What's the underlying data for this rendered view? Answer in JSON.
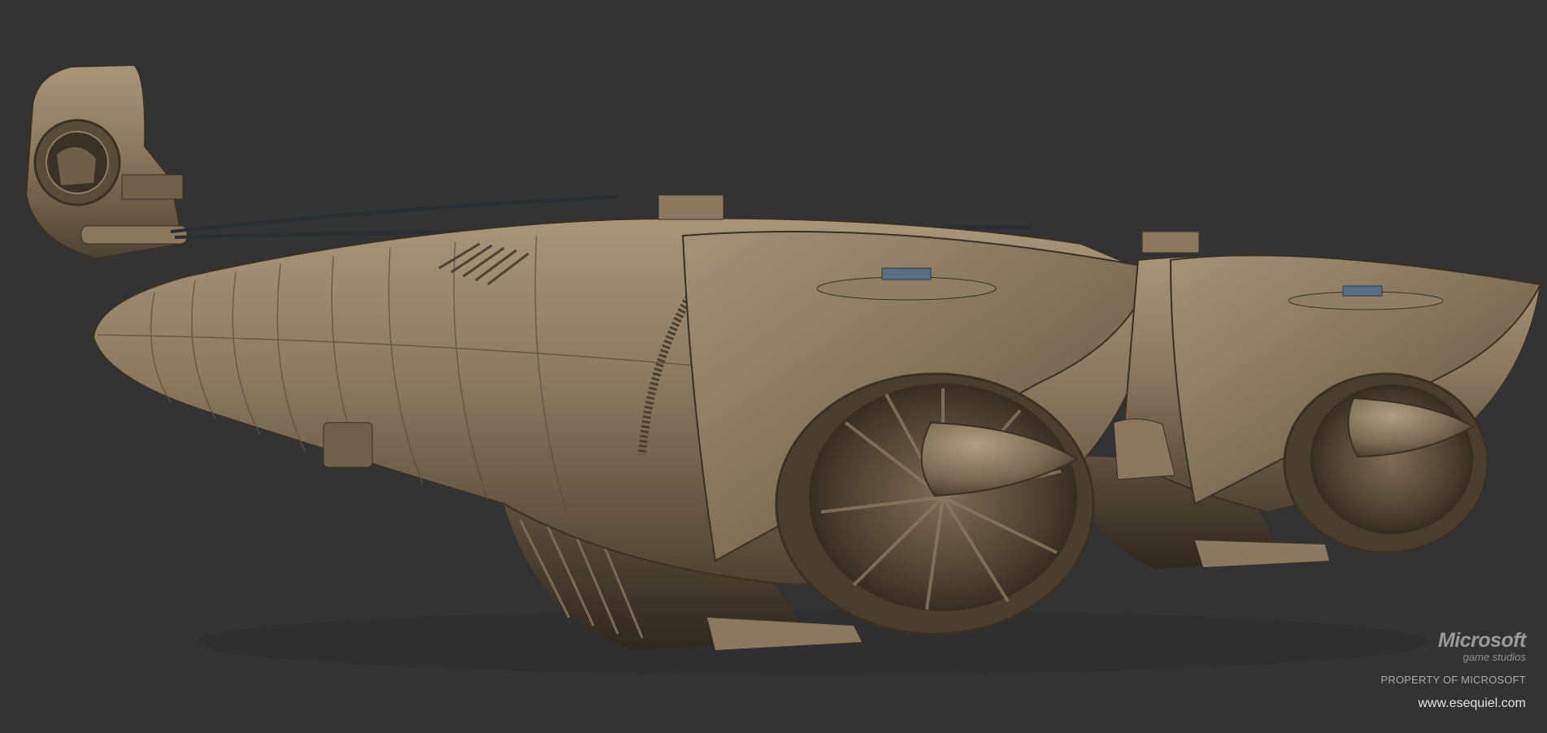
{
  "watermark": {
    "brand": "Microsoft",
    "division": "game studios",
    "notice": "PROPERTY OF MICROSOFT",
    "website": "www.esequiel.com"
  },
  "colors": {
    "background": "#333333",
    "hull": "#7a6a54",
    "hull_light": "#a8957a",
    "hull_dark": "#3e3428",
    "cable": "#2a2d34",
    "accent_blue": "#5a6f86"
  },
  "icons": [
    "microsoft-game-studios-logo"
  ]
}
